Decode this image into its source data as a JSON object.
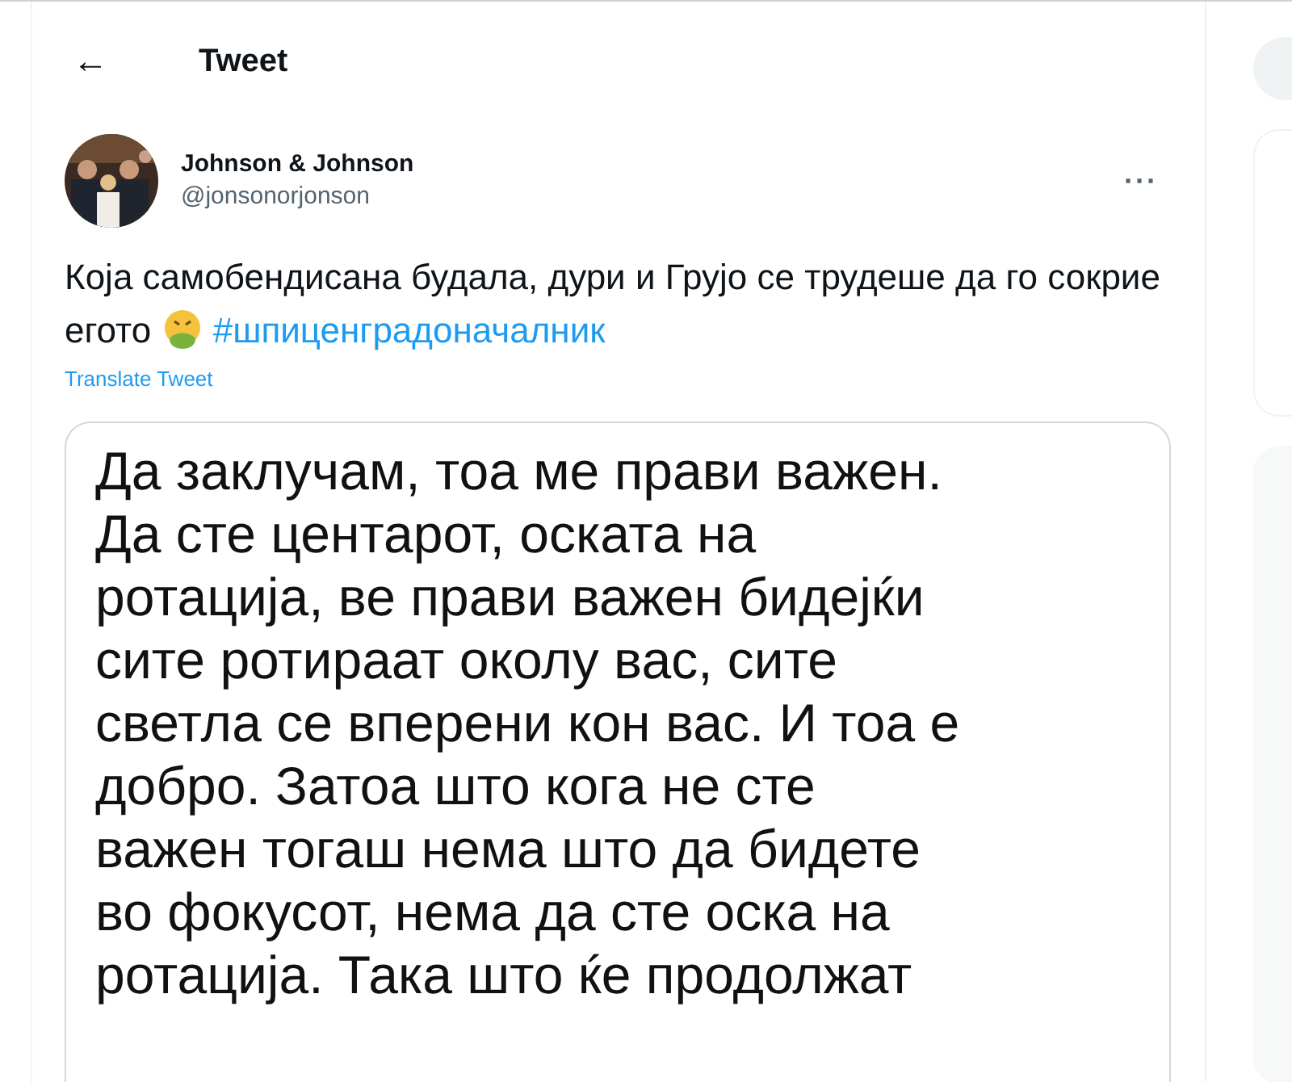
{
  "header": {
    "back": "←",
    "title": "Tweet"
  },
  "tweet": {
    "author": "Johnson & Johnson",
    "handle": "@jonsonorjonson",
    "more": "···",
    "text_parts": [
      {
        "kind": "text",
        "text": "Која самобендисана будала, дури и Грујо се трудеше да го сокрие егото"
      },
      {
        "kind": "emoji"
      },
      {
        "kind": "hashtag",
        "text": "#шпиценградоначалник"
      }
    ],
    "translate": "Translate Tweet",
    "image_lines": [
      "Да заклучам, тоа ме прави важен.",
      "Да сте центарот, оската на",
      "ротација, ве прави важен бидејќи",
      "сите ротираат околу вас, сите",
      "светла се вперени кон вас. И тоа е",
      "добро. Затоа што кога не сте",
      "важен тогаш нема што да бидете",
      "во фокусот, нема да сте оска на",
      "ротација. Така што ќе продолжат"
    ]
  }
}
